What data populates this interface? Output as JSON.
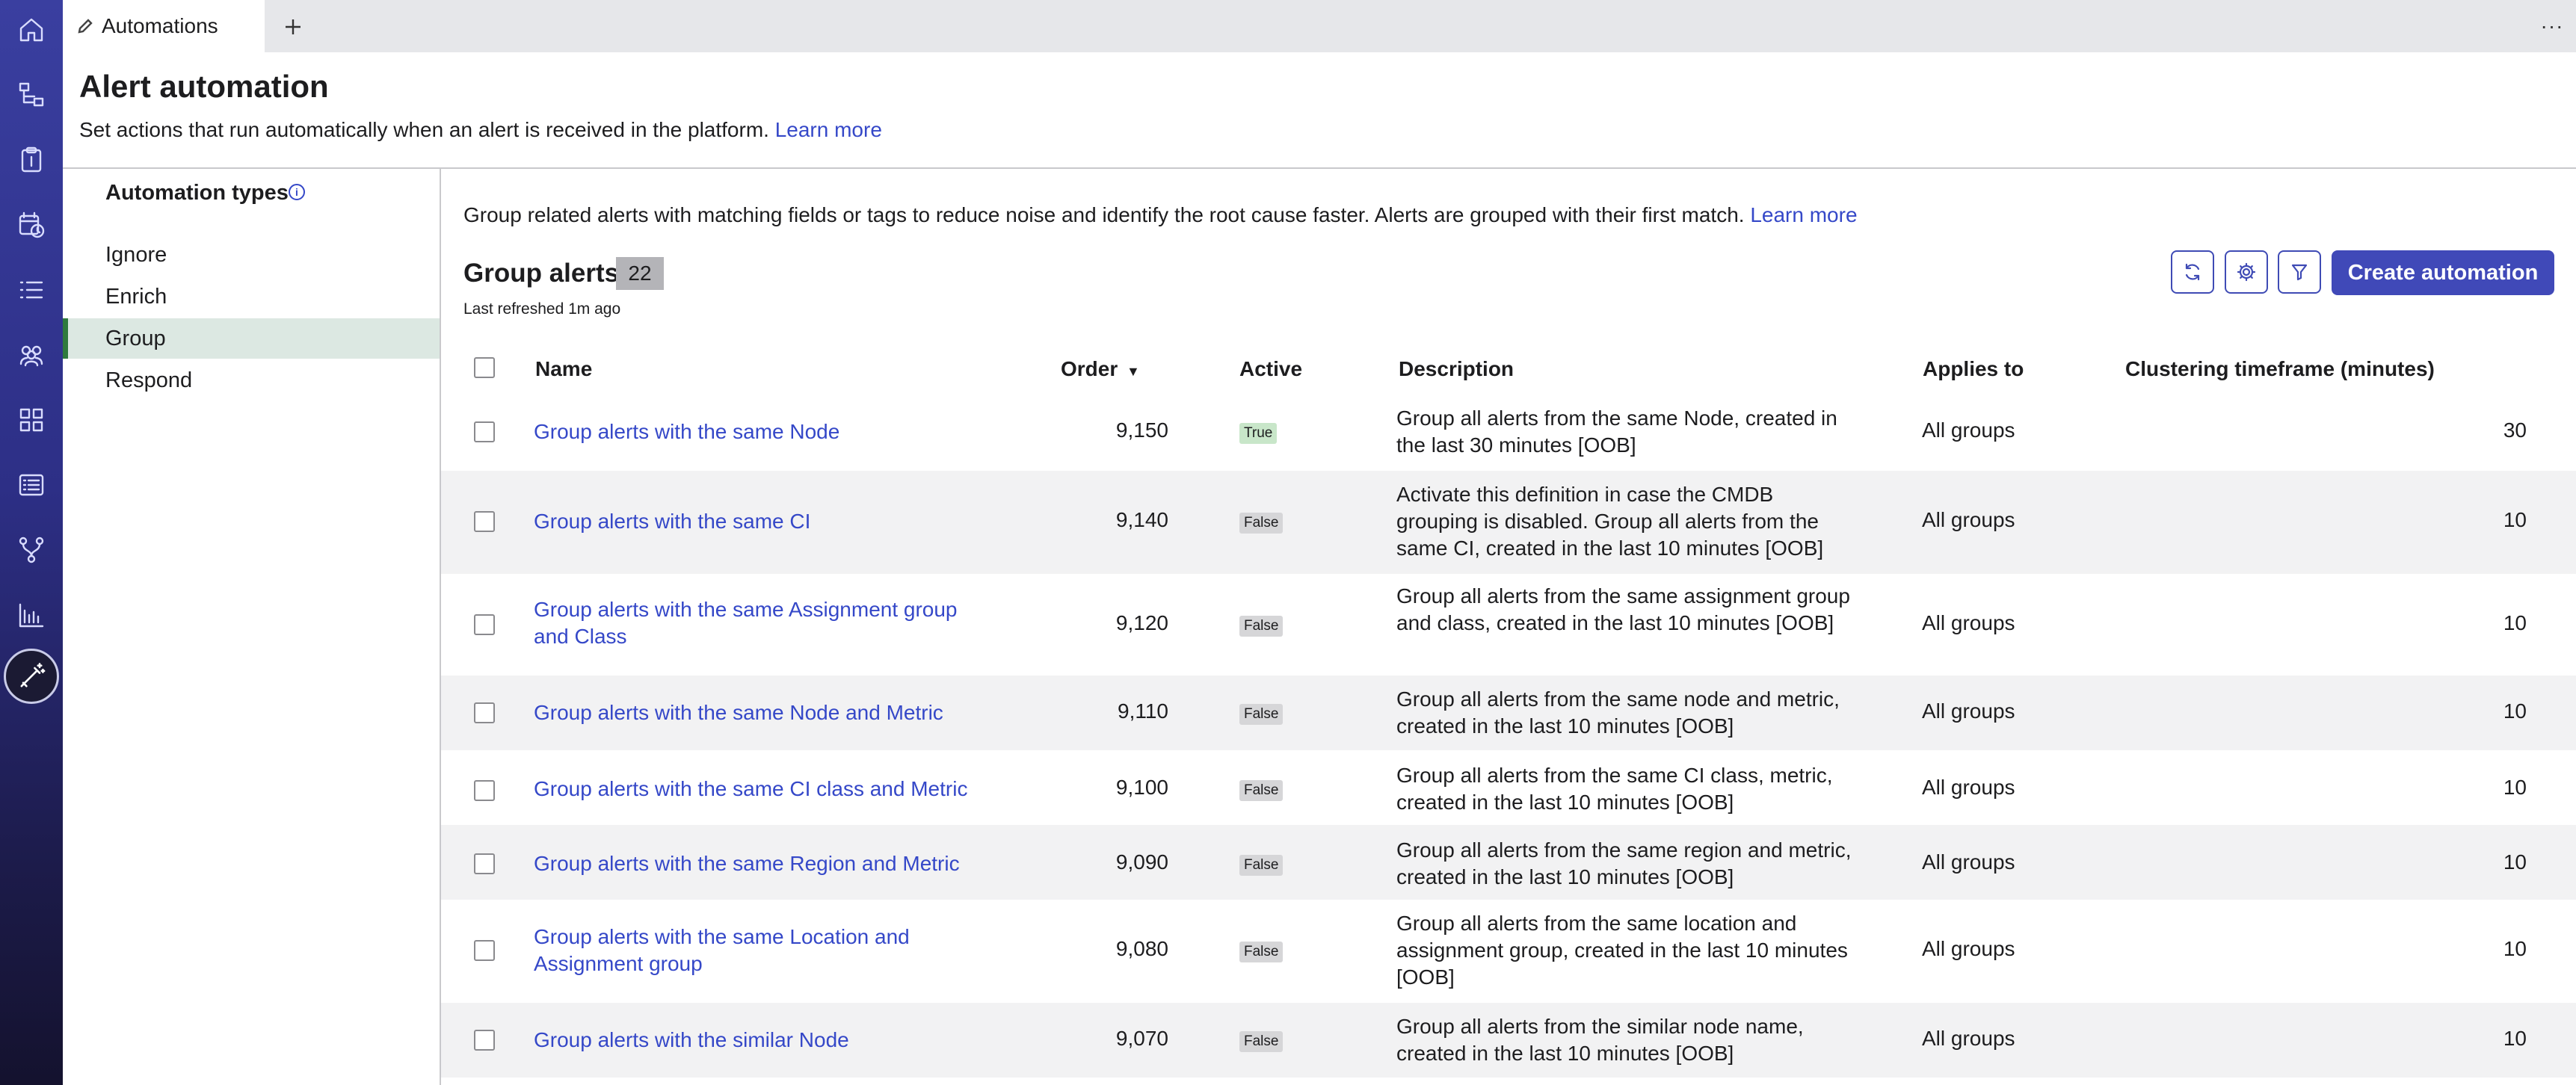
{
  "tab": {
    "label": "Automations"
  },
  "header": {
    "title": "Alert automation",
    "subtitle": "Set actions that run automatically when an alert is received in the platform.",
    "learn_more": "Learn more"
  },
  "sidenav": {
    "title": "Automation types",
    "items": [
      "Ignore",
      "Enrich",
      "Group",
      "Respond"
    ],
    "selected": "Group"
  },
  "main": {
    "description": "Group related alerts with matching fields or tags to reduce noise and identify the root cause faster. Alerts are grouped with their first match.",
    "learn_more": "Learn more",
    "title": "Group alerts",
    "count": "22",
    "last_refreshed": "Last refreshed 1m ago",
    "create_button": "Create automation"
  },
  "table": {
    "columns": {
      "name": "Name",
      "order": "Order",
      "active": "Active",
      "description": "Description",
      "applies_to": "Applies to",
      "clustering": "Clustering timeframe (minutes)"
    },
    "rows": [
      {
        "name": "Group alerts with the same Node",
        "order": "9,150",
        "active": "True",
        "description": "Group all alerts from the same Node, created in the last 30 minutes [OOB]",
        "applies_to": "All groups",
        "timeframe": "30"
      },
      {
        "name": "Group alerts with the same CI",
        "order": "9,140",
        "active": "False",
        "description": "Activate this definition in case the CMDB grouping is disabled. Group all alerts from the same CI, created in the last 10 minutes [OOB]",
        "applies_to": "All groups",
        "timeframe": "10"
      },
      {
        "name": "Group alerts with the same Assignment group and Class",
        "order": "9,120",
        "active": "False",
        "description": "Group all alerts from the same assignment group and class, created in the last 10 minutes [OOB]",
        "applies_to": "All groups",
        "timeframe": "10"
      },
      {
        "name": "Group alerts with the same Node and Metric",
        "order": "9,110",
        "active": "False",
        "description": "Group all alerts from the same node and metric, created in the last 10 minutes  [OOB]",
        "applies_to": "All groups",
        "timeframe": "10"
      },
      {
        "name": "Group alerts with the same CI class and Metric",
        "order": "9,100",
        "active": "False",
        "description": "Group all alerts from the same CI class, metric, created in the last 10 minutes [OOB]",
        "applies_to": "All groups",
        "timeframe": "10"
      },
      {
        "name": "Group alerts with the same Region and Metric",
        "order": "9,090",
        "active": "False",
        "description": "Group all alerts from the same region and metric, created in the last 10 minutes [OOB]",
        "applies_to": "All groups",
        "timeframe": "10"
      },
      {
        "name": "Group alerts with the same Location and Assignment group",
        "order": "9,080",
        "active": "False",
        "description": "Group all alerts from the same location and assignment group, created in the last 10 minutes [OOB]",
        "applies_to": "All groups",
        "timeframe": "10"
      },
      {
        "name": "Group alerts with the similar Node",
        "order": "9,070",
        "active": "False",
        "description": "Group all alerts from the similar node name, created in the last 10 minutes [OOB]",
        "applies_to": "All groups",
        "timeframe": "10"
      }
    ]
  },
  "colors": {
    "accent": "#4049b8",
    "link": "#3548c8",
    "selected_nav": "#dce8e2",
    "rail_top": "#3a3fa0"
  }
}
